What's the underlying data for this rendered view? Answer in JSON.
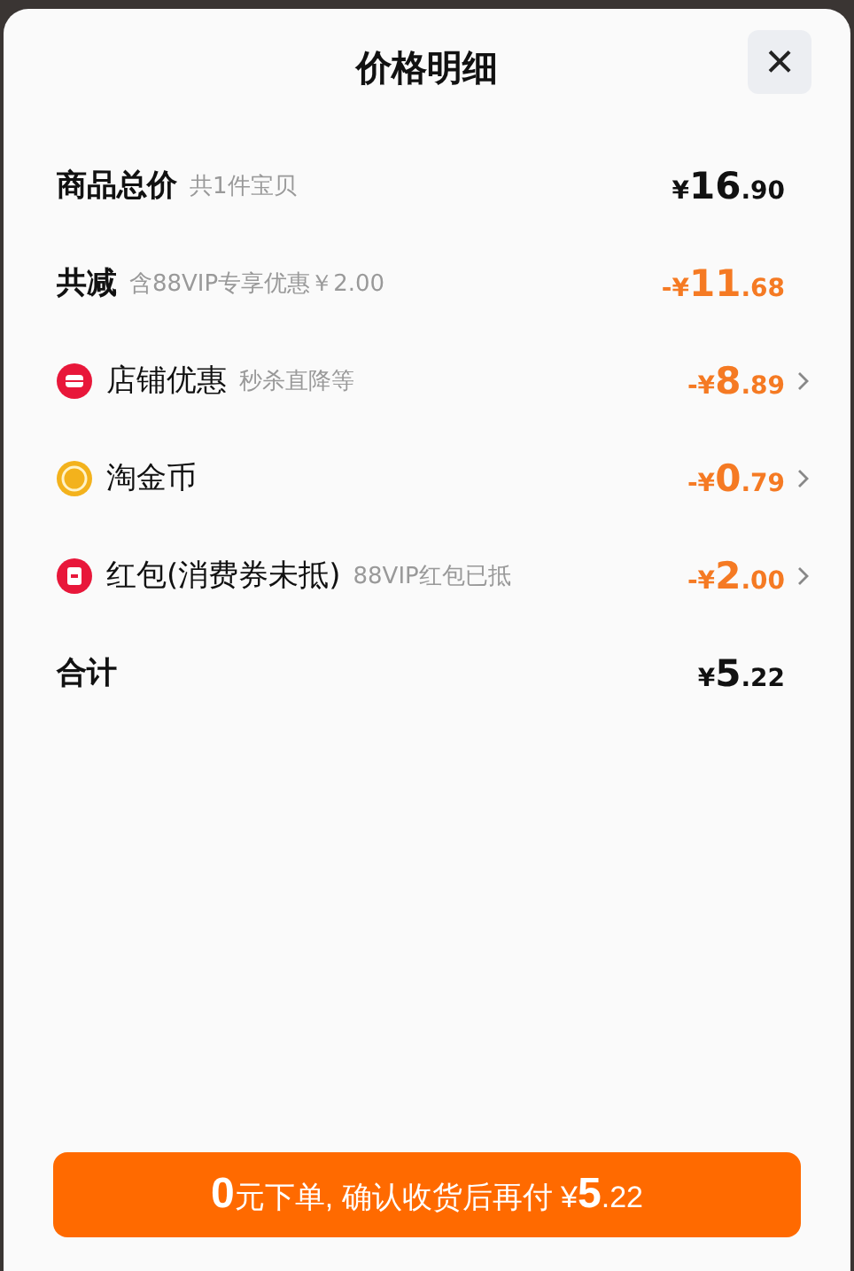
{
  "sheet": {
    "title": "价格明细",
    "close": "×"
  },
  "rows": [
    {
      "kind": "subtotal",
      "label": "商品总价",
      "note": "共1件宝贝",
      "amount": {
        "sign": "¥",
        "int": "16",
        "dec": ".90"
      }
    },
    {
      "kind": "deduct",
      "label": "共减",
      "note": "含88VIP专享优惠￥2.00",
      "amount": {
        "sign": "-¥",
        "int": "11",
        "dec": ".68"
      }
    },
    {
      "kind": "store",
      "label": "店铺优惠",
      "note": "秒杀直降等",
      "amount": {
        "sign": "-¥",
        "int": "8",
        "dec": ".89"
      }
    },
    {
      "kind": "coin",
      "label": "淘金币",
      "amount": {
        "sign": "-¥",
        "int": "0",
        "dec": ".79"
      }
    },
    {
      "kind": "packet",
      "label": "红包(消费券未抵)",
      "note": "88VIP红包已抵",
      "amount": {
        "sign": "-¥",
        "int": "2",
        "dec": ".00"
      }
    },
    {
      "kind": "total",
      "label": "合计",
      "amount": {
        "sign": "¥",
        "int": "5",
        "dec": ".22"
      }
    }
  ],
  "button": {
    "parts": [
      {
        "text": "0",
        "big": true
      },
      {
        "text": "元下单, 确认收货后再付 ¥",
        "big": false
      },
      {
        "text": "5",
        "big": true
      },
      {
        "text": ".22",
        "big": false
      }
    ]
  }
}
